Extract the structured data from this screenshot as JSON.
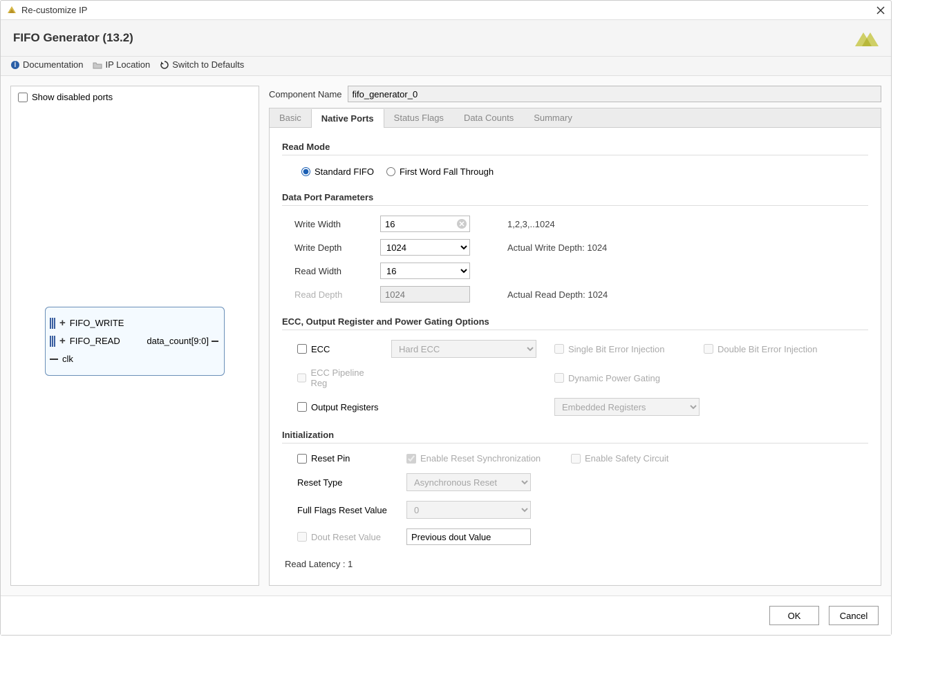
{
  "window": {
    "title": "Re-customize IP"
  },
  "header": {
    "title": "FIFO Generator (13.2)"
  },
  "toolbar": {
    "documentation": "Documentation",
    "ip_location": "IP Location",
    "switch_defaults": "Switch to Defaults"
  },
  "left": {
    "show_disabled_ports": "Show disabled ports",
    "ports": {
      "fifo_write": "FIFO_WRITE",
      "fifo_read": "FIFO_READ",
      "clk": "clk",
      "data_count": "data_count[9:0]"
    }
  },
  "component": {
    "label": "Component Name",
    "value": "fifo_generator_0"
  },
  "tabs": {
    "basic": "Basic",
    "native_ports": "Native Ports",
    "status_flags": "Status Flags",
    "data_counts": "Data Counts",
    "summary": "Summary"
  },
  "read_mode": {
    "title": "Read Mode",
    "standard": "Standard FIFO",
    "fwft": "First Word Fall Through"
  },
  "data_port": {
    "title": "Data Port Parameters",
    "write_width_label": "Write Width",
    "write_width_value": "16",
    "write_width_hint": "1,2,3,..1024",
    "write_depth_label": "Write Depth",
    "write_depth_value": "1024",
    "write_depth_hint": "Actual Write Depth: 1024",
    "read_width_label": "Read Width",
    "read_width_value": "16",
    "read_depth_label": "Read Depth",
    "read_depth_value": "1024",
    "read_depth_hint": "Actual Read Depth: 1024"
  },
  "ecc": {
    "title": "ECC, Output Register and Power Gating Options",
    "ecc_label": "ECC",
    "hard_ecc": "Hard ECC",
    "single_bit": "Single Bit Error Injection",
    "double_bit": "Double Bit Error Injection",
    "pipeline": "ECC Pipeline Reg",
    "dyn_power": "Dynamic Power Gating",
    "output_reg": "Output Registers",
    "embedded_reg": "Embedded Registers"
  },
  "init": {
    "title": "Initialization",
    "reset_pin": "Reset Pin",
    "enable_sync": "Enable Reset Synchronization",
    "enable_safety": "Enable Safety Circuit",
    "reset_type_label": "Reset Type",
    "reset_type_value": "Asynchronous Reset",
    "full_flags_label": "Full Flags Reset Value",
    "full_flags_value": "0",
    "dout_reset_label": "Dout Reset Value",
    "dout_reset_value": "Previous dout Value"
  },
  "read_latency": "Read Latency : 1",
  "footer": {
    "ok": "OK",
    "cancel": "Cancel"
  }
}
